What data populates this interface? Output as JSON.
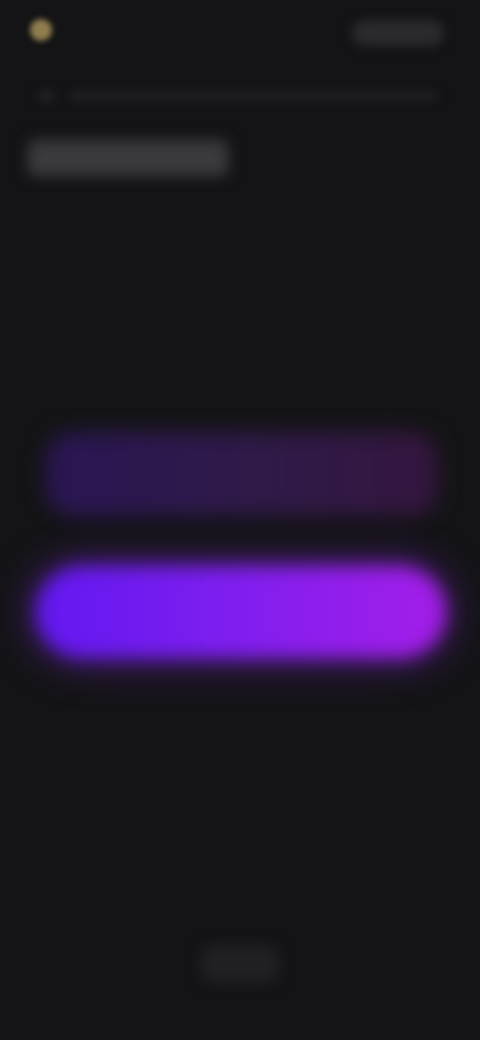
{
  "header": {
    "logo_icon": "brand-logo-icon",
    "brand_text": "",
    "action_label": ""
  },
  "breadcrumb": {
    "label": ""
  },
  "page": {
    "title": ""
  },
  "buttons": {
    "secondary_label": "",
    "primary_label": ""
  },
  "footer": {
    "link_label": ""
  },
  "colors": {
    "background": "#141416",
    "primary_gradient_start": "#6218f0",
    "primary_gradient_end": "#a41ee8",
    "secondary_tint": "#2a1654"
  }
}
